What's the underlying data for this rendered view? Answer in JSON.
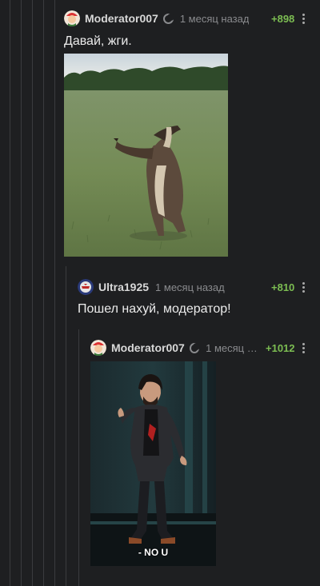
{
  "comments": [
    {
      "username": "Moderator007",
      "time": "1 месяц назад",
      "score": "+898",
      "text": "Давай, жги."
    },
    {
      "username": "Ultra1925",
      "time": "1 месяц назад",
      "score": "+810",
      "text": "Пошел нахуй, модератор!"
    },
    {
      "username": "Moderator007",
      "time": "1 месяц на...",
      "score": "+1012",
      "caption": "- NO U"
    }
  ],
  "icons": {
    "menu": "more-vertical-icon",
    "status": "moon-icon"
  },
  "colors": {
    "background": "#1e1f21",
    "score": "#7cbd52",
    "muted": "#8a8b8e",
    "thread_line": "#3a3b3e"
  }
}
